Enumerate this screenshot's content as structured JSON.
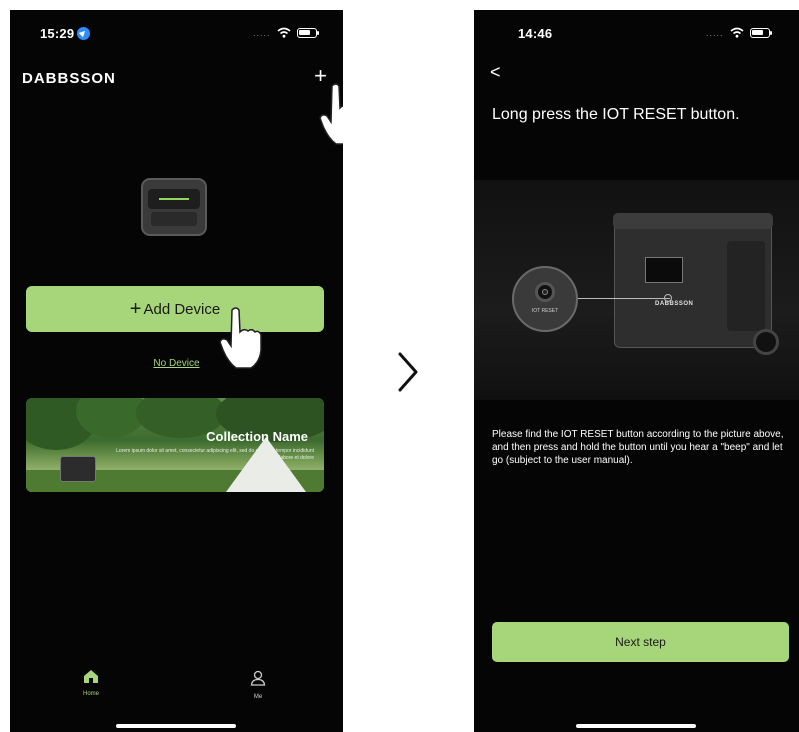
{
  "left_screen": {
    "status": {
      "time": "15:29",
      "signal_dots": "....."
    },
    "header": {
      "brand": "DABBSSON",
      "add_icon": "+"
    },
    "add_device_label": "Add Device",
    "no_device_link": "No Device",
    "banner": {
      "title": "Collection Name",
      "subtitle": "Lorem ipsum dolor sit amet, consectetur adipiscing elit, sed do eiusmod tempor incididunt ut labore et dolore"
    },
    "tabs": [
      {
        "label": "Home",
        "icon": "home-icon"
      },
      {
        "label": "Me",
        "icon": "person-icon"
      }
    ]
  },
  "between_arrow": ">",
  "right_screen": {
    "status": {
      "time": "14:46",
      "signal_dots": "....."
    },
    "back_icon": "<",
    "title": "Long press the IOT RESET button.",
    "illustration": {
      "button_label": "IOT RESET",
      "device_logo": "DABBSSON"
    },
    "description": "Please find the IOT RESET button according to the picture above, and then press and hold the button until you hear a \"beep\" and let go (subject to the user manual).",
    "next_button": "Next step"
  },
  "colors": {
    "accent": "#a7d67a",
    "background": "#050505"
  }
}
